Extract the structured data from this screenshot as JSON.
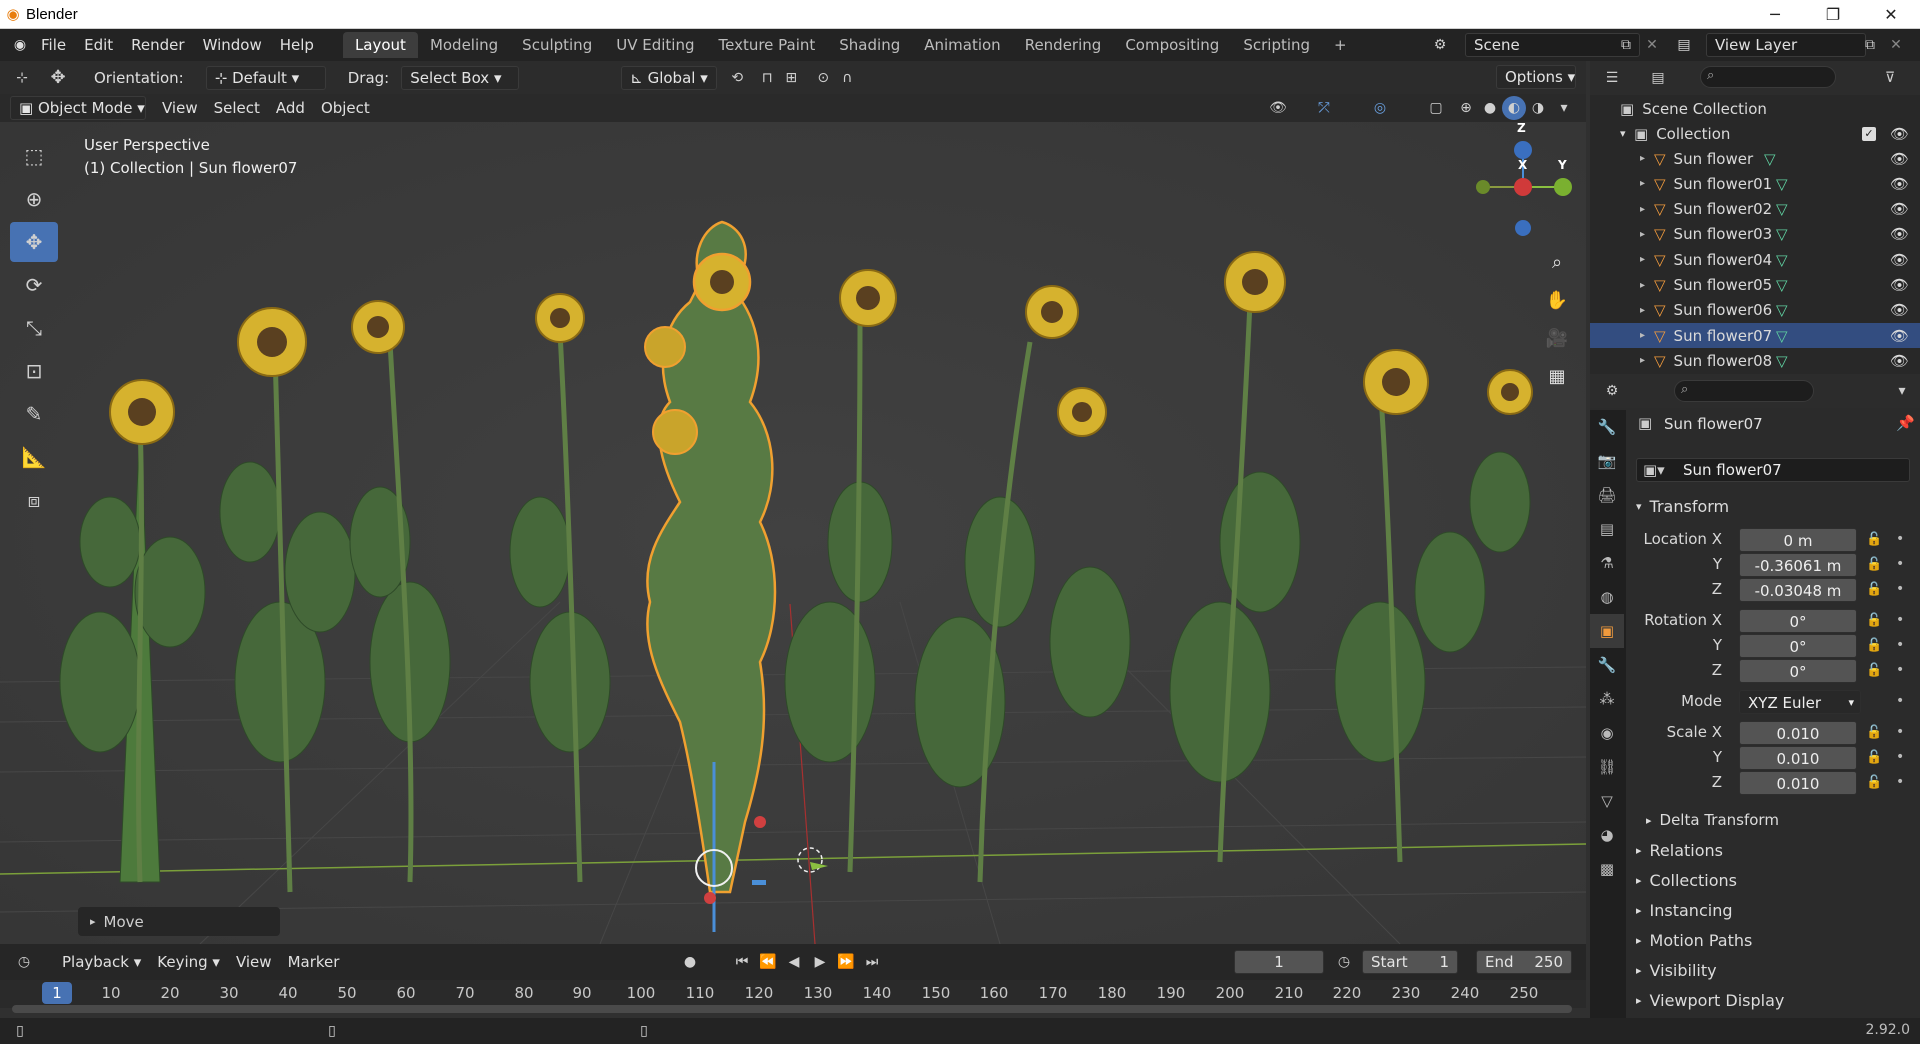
{
  "titlebar": {
    "app_title": "Blender",
    "minimize": "─",
    "maximize": "❐",
    "close": "✕"
  },
  "menu": [
    "File",
    "Edit",
    "Render",
    "Window",
    "Help"
  ],
  "workspaces": [
    "Layout",
    "Modeling",
    "Sculpting",
    "UV Editing",
    "Texture Paint",
    "Shading",
    "Animation",
    "Rendering",
    "Compositing",
    "Scripting"
  ],
  "workspace_add": "+",
  "scene": {
    "name": "Scene",
    "view_layer": "View Layer"
  },
  "tool_header": {
    "orientation_label": "Orientation:",
    "orientation_value": "Default",
    "drag_label": "Drag:",
    "drag_value": "Select Box",
    "transform_orientation": "Global",
    "options": "Options"
  },
  "view_header": {
    "mode": "Object Mode",
    "items": [
      "View",
      "Select",
      "Add",
      "Object"
    ]
  },
  "viewport": {
    "perspective": "User Perspective",
    "context": "(1) Collection | Sun flower07",
    "gizmo": {
      "z": "Z",
      "x": "X",
      "y": "Y"
    },
    "last_op": "Move"
  },
  "timeline": {
    "menus": [
      "Playback",
      "Keying",
      "View",
      "Marker"
    ],
    "current_frame": "1",
    "start_label": "Start",
    "start": "1",
    "end_label": "End",
    "end": "250",
    "ruler": [
      "10",
      "20",
      "30",
      "40",
      "50",
      "60",
      "70",
      "80",
      "90",
      "100",
      "110",
      "120",
      "130",
      "140",
      "150",
      "160",
      "170",
      "180",
      "190",
      "200",
      "210",
      "220",
      "230",
      "240",
      "250"
    ],
    "marker": "1"
  },
  "outliner": {
    "scene_collection": "Scene Collection",
    "collection": "Collection",
    "objects": [
      "Sun flower",
      "Sun flower01",
      "Sun flower02",
      "Sun flower03",
      "Sun flower04",
      "Sun flower05",
      "Sun flower06",
      "Sun flower07",
      "Sun flower08"
    ],
    "selected_index": 7
  },
  "properties": {
    "object_name": "Sun flower07",
    "object_field": "Sun flower07",
    "transform": "Transform",
    "location_label": "Location X",
    "rotation_label": "Rotation X",
    "scale_label": "Scale X",
    "y_label": "Y",
    "z_label": "Z",
    "location": [
      "0 m",
      "-0.36061 m",
      "-0.03048 m"
    ],
    "rotation": [
      "0°",
      "0°",
      "0°"
    ],
    "mode_label": "Mode",
    "mode_value": "XYZ Euler",
    "scale": [
      "0.010",
      "0.010",
      "0.010"
    ],
    "delta": "Delta Transform",
    "sections": [
      "Relations",
      "Collections",
      "Instancing",
      "Motion Paths",
      "Visibility",
      "Viewport Display"
    ]
  },
  "status": {
    "version": "2.92.0"
  },
  "colors": {
    "accent": "#4772b3",
    "selection": "#f0a030",
    "active_tab": "#f09a3d"
  }
}
